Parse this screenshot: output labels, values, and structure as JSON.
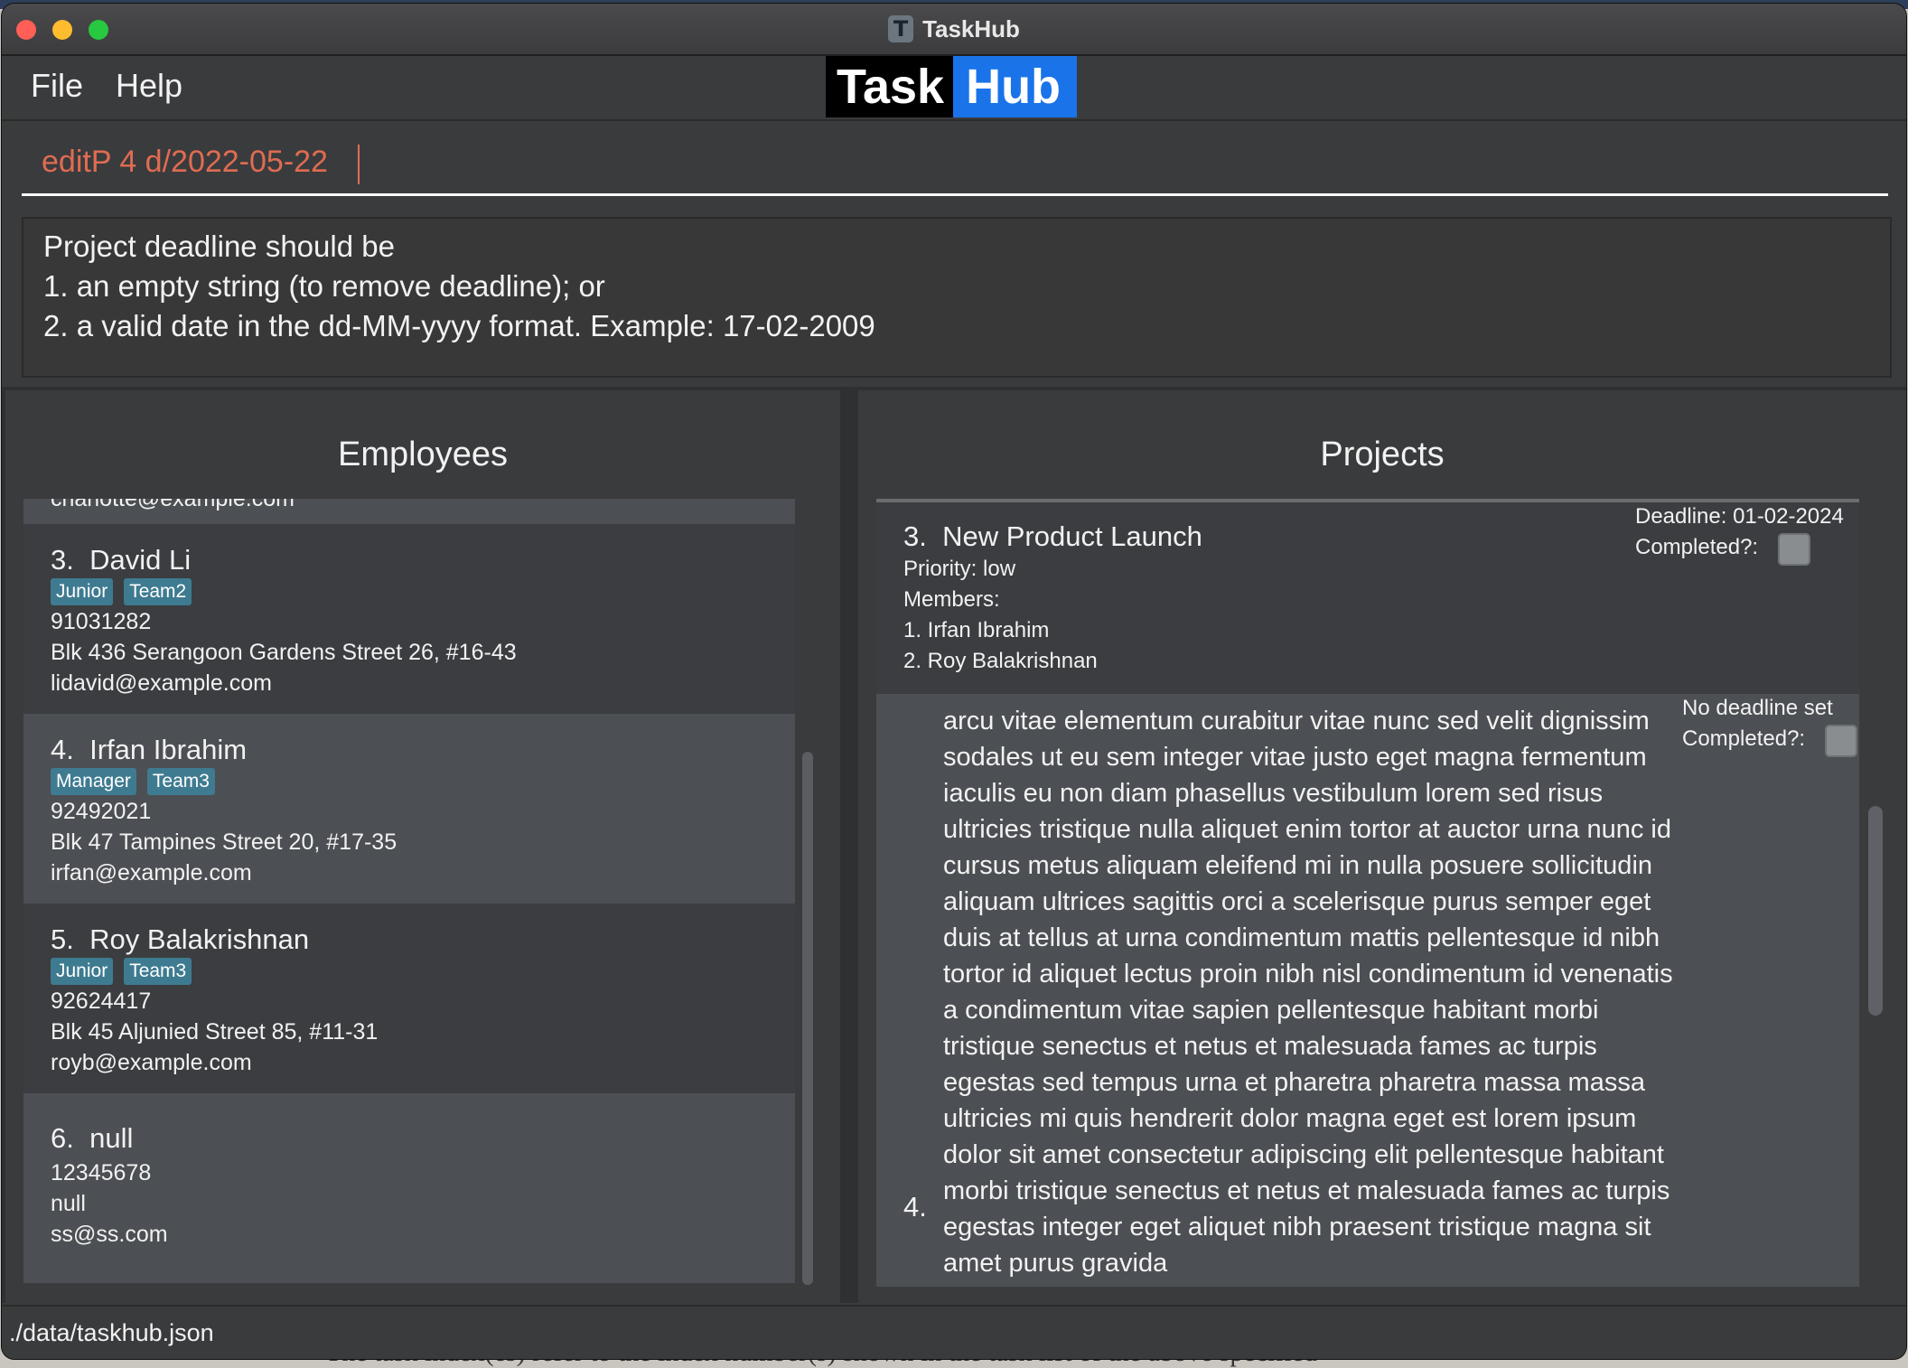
{
  "window": {
    "title": "TaskHub"
  },
  "menu": {
    "file": "File",
    "help": "Help"
  },
  "logo": {
    "part1": "Task",
    "part2": "Hub"
  },
  "command": {
    "value": "editP 4 d/2022-05-22"
  },
  "result": {
    "lines": [
      "Project deadline should be",
      "1. an empty string (to remove deadline); or",
      "2. a valid date in the dd-MM-yyyy format. Example: 17-02-2009"
    ]
  },
  "employees": {
    "title": "Employees",
    "partial_email": "charlotte@example.com",
    "items": [
      {
        "index": "3.",
        "name": "David Li",
        "tags": [
          "Junior",
          "Team2"
        ],
        "phone": "91031282",
        "address": "Blk 436 Serangoon Gardens Street 26, #16-43",
        "email": "lidavid@example.com"
      },
      {
        "index": "4.",
        "name": "Irfan Ibrahim",
        "tags": [
          "Manager",
          "Team3"
        ],
        "phone": "92492021",
        "address": "Blk 47 Tampines Street 20, #17-35",
        "email": "irfan@example.com"
      },
      {
        "index": "5.",
        "name": "Roy Balakrishnan",
        "tags": [
          "Junior",
          "Team3"
        ],
        "phone": "92624417",
        "address": "Blk 45 Aljunied Street 85, #11-31",
        "email": "royb@example.com"
      },
      {
        "index": "6.",
        "name": "null",
        "tags": [],
        "phone": "12345678",
        "address": "null",
        "email": "ss@ss.com"
      }
    ]
  },
  "projects": {
    "title": "Projects",
    "items": [
      {
        "index": "3.",
        "name": "New Product Launch",
        "priority": "Priority: low",
        "deadline": "Deadline: 01-02-2024",
        "completed_label": "Completed?:",
        "members_label": "Members:",
        "members": [
          "1. Irfan Ibrahim",
          "2. Roy Balakrishnan"
        ]
      },
      {
        "index": "4.",
        "deadline": "No deadline set",
        "completed_label": "Completed?:",
        "description": "arcu vitae elementum curabitur vitae nunc sed velit dignissim sodales ut eu sem integer vitae justo eget magna fermentum iaculis eu non diam phasellus vestibulum lorem sed risus ultricies tristique nulla aliquet enim tortor at auctor urna nunc id cursus metus aliquam eleifend mi in nulla posuere sollicitudin aliquam ultrices sagittis orci a scelerisque purus semper eget duis at tellus at urna condimentum mattis pellentesque id nibh tortor id aliquet lectus proin nibh nisl condimentum id venenatis a condimentum vitae sapien pellentesque habitant morbi tristique senectus et netus et malesuada fames ac turpis egestas sed tempus urna et pharetra pharetra massa massa ultricies mi quis hendrerit dolor magna eget est lorem ipsum dolor sit amet consectetur adipiscing elit pellentesque habitant morbi tristique senectus et netus et malesuada fames ac turpis egestas integer eget aliquet nibh praesent tristique magna sit amet purus gravida"
      }
    ]
  },
  "status": {
    "file_path": "./data/taskhub.json"
  },
  "background_text": "The task index(es) refer to the index number(s) shown in the task list of the above specified",
  "colors": {
    "command_text": "#e06c52",
    "tag_bg": "#3e7b91",
    "logo_blue": "#1a73e8",
    "deadline_green": "#1a8c1a"
  }
}
